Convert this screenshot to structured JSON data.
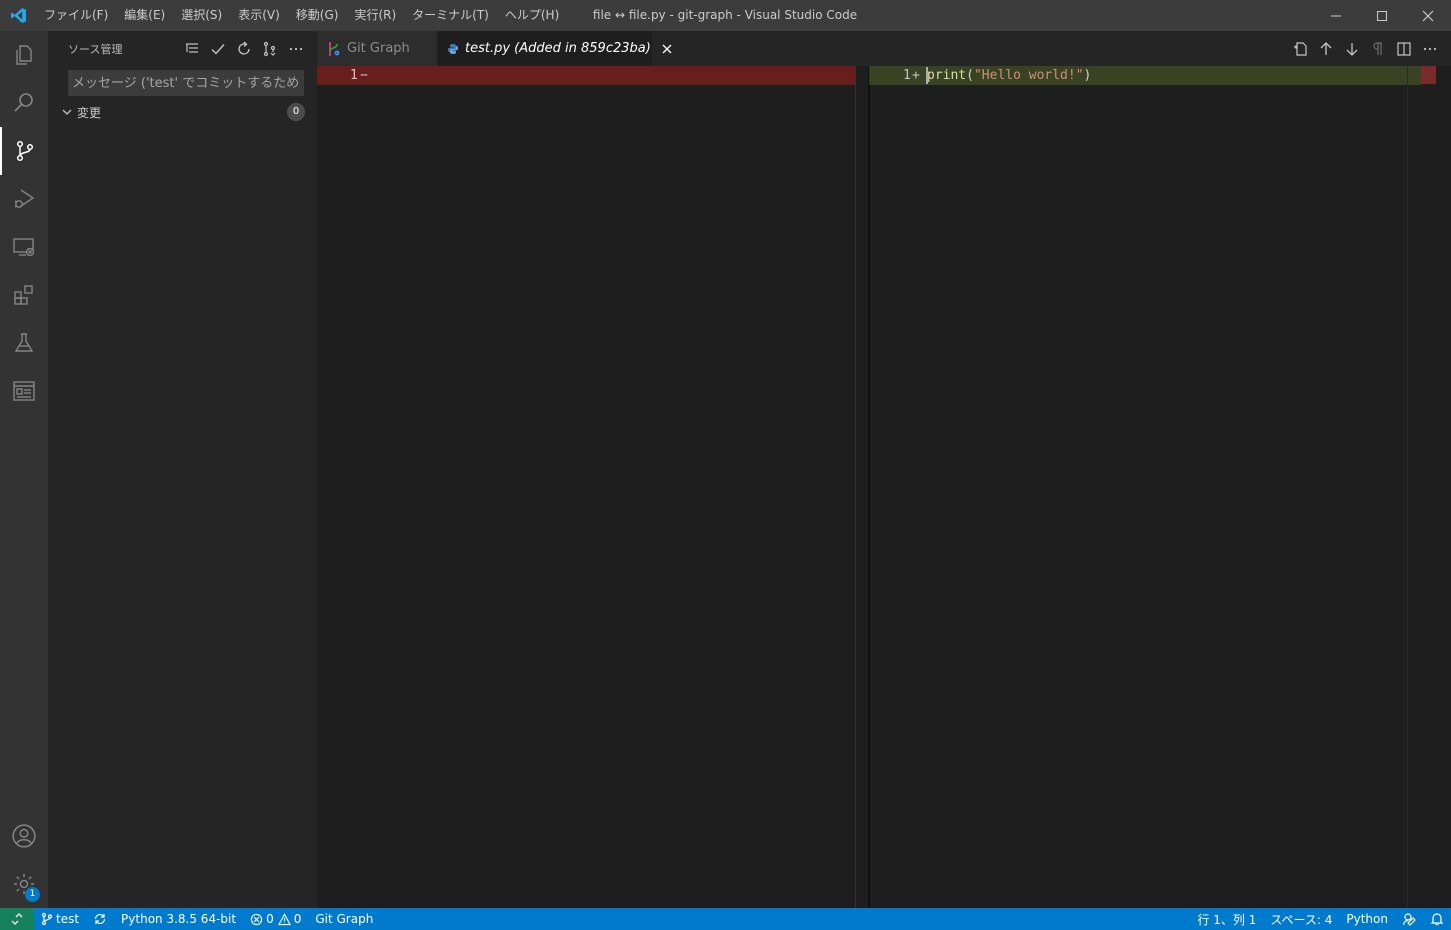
{
  "titlebar": {
    "menu": [
      "ファイル(F)",
      "編集(E)",
      "選択(S)",
      "表示(V)",
      "移動(G)",
      "実行(R)",
      "ターミナル(T)",
      "ヘルプ(H)"
    ],
    "title": "file ↔ file.py - git-graph - Visual Studio Code"
  },
  "activitybar": {
    "items": [
      "files-icon",
      "search-icon",
      "source-control-icon",
      "run-debug-icon",
      "remote-explorer-icon",
      "extensions-icon",
      "testing-icon",
      "git-graph-icon"
    ],
    "settings_badge": "1"
  },
  "sidebar": {
    "title": "ソース管理",
    "commit_placeholder": "メッセージ ('test' でコミットするため...",
    "changes_label": "変更",
    "changes_count": "0"
  },
  "tabs": {
    "git_graph": "Git Graph",
    "test_py": "test.py (Added in 859c23ba)"
  },
  "editor": {
    "left_line_no": "1",
    "left_marker": "−",
    "right_line_no": "1",
    "right_marker": "+",
    "code_fn": "print",
    "code_open": "(",
    "code_str": "\"Hello world!\"",
    "code_close": ")"
  },
  "statusbar": {
    "branch": "test",
    "python": "Python 3.8.5 64-bit",
    "errors": "0",
    "warnings": "0",
    "git_graph": "Git Graph",
    "position": "行 1、列 1",
    "spaces": "スペース: 4",
    "language": "Python"
  },
  "colors": {
    "accent": "#007acc",
    "remote": "#16825d",
    "deleted_line": "#6b2222",
    "added_line": "#3d4a23"
  }
}
